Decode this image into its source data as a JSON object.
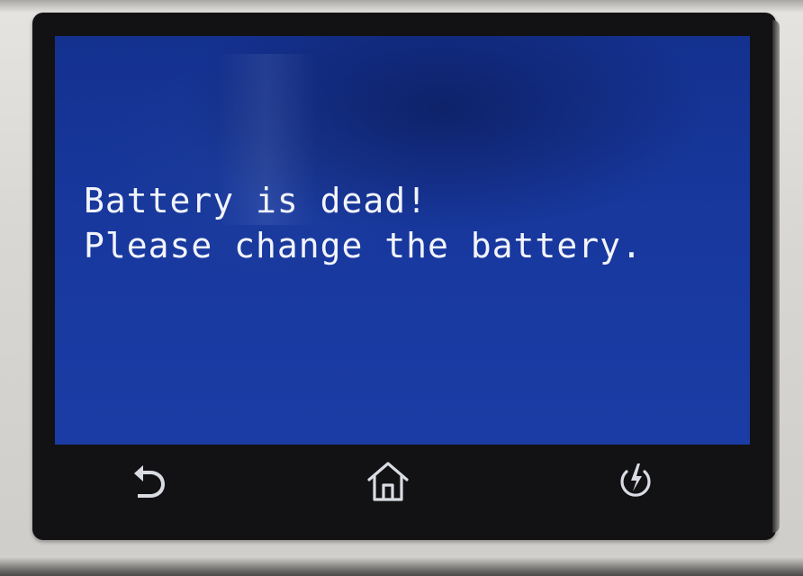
{
  "screen": {
    "message_line_1": "Battery is dead!",
    "message_line_2": "Please change the battery."
  },
  "nav": {
    "back_icon": "back-arrow-icon",
    "home_icon": "home-icon",
    "power_icon": "power-icon"
  },
  "colors": {
    "screen_background": "#1a3ca4",
    "text": "#f2f4fa",
    "bezel": "#121214",
    "icon": "#d9dce3"
  }
}
